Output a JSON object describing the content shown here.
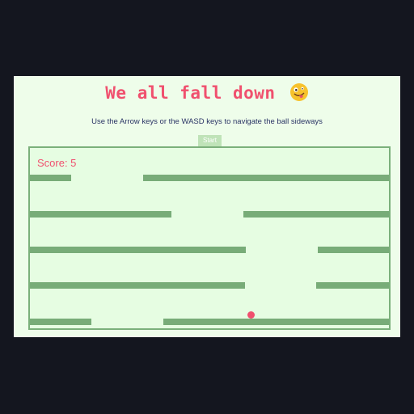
{
  "header": {
    "title": "We all fall down",
    "title_emoji_icon": "zany-face-icon",
    "instructions": "Use the Arrow keys or the WASD keys to navigate the ball sideways"
  },
  "controls": {
    "start_label": "Start"
  },
  "game": {
    "score_text": "Score: 5",
    "colors": {
      "accent": "#f0506e",
      "platform": "#78ac78",
      "board_background": "#e6fde2",
      "panel_background": "#eefdea",
      "page_background": "#14161f"
    }
  }
}
